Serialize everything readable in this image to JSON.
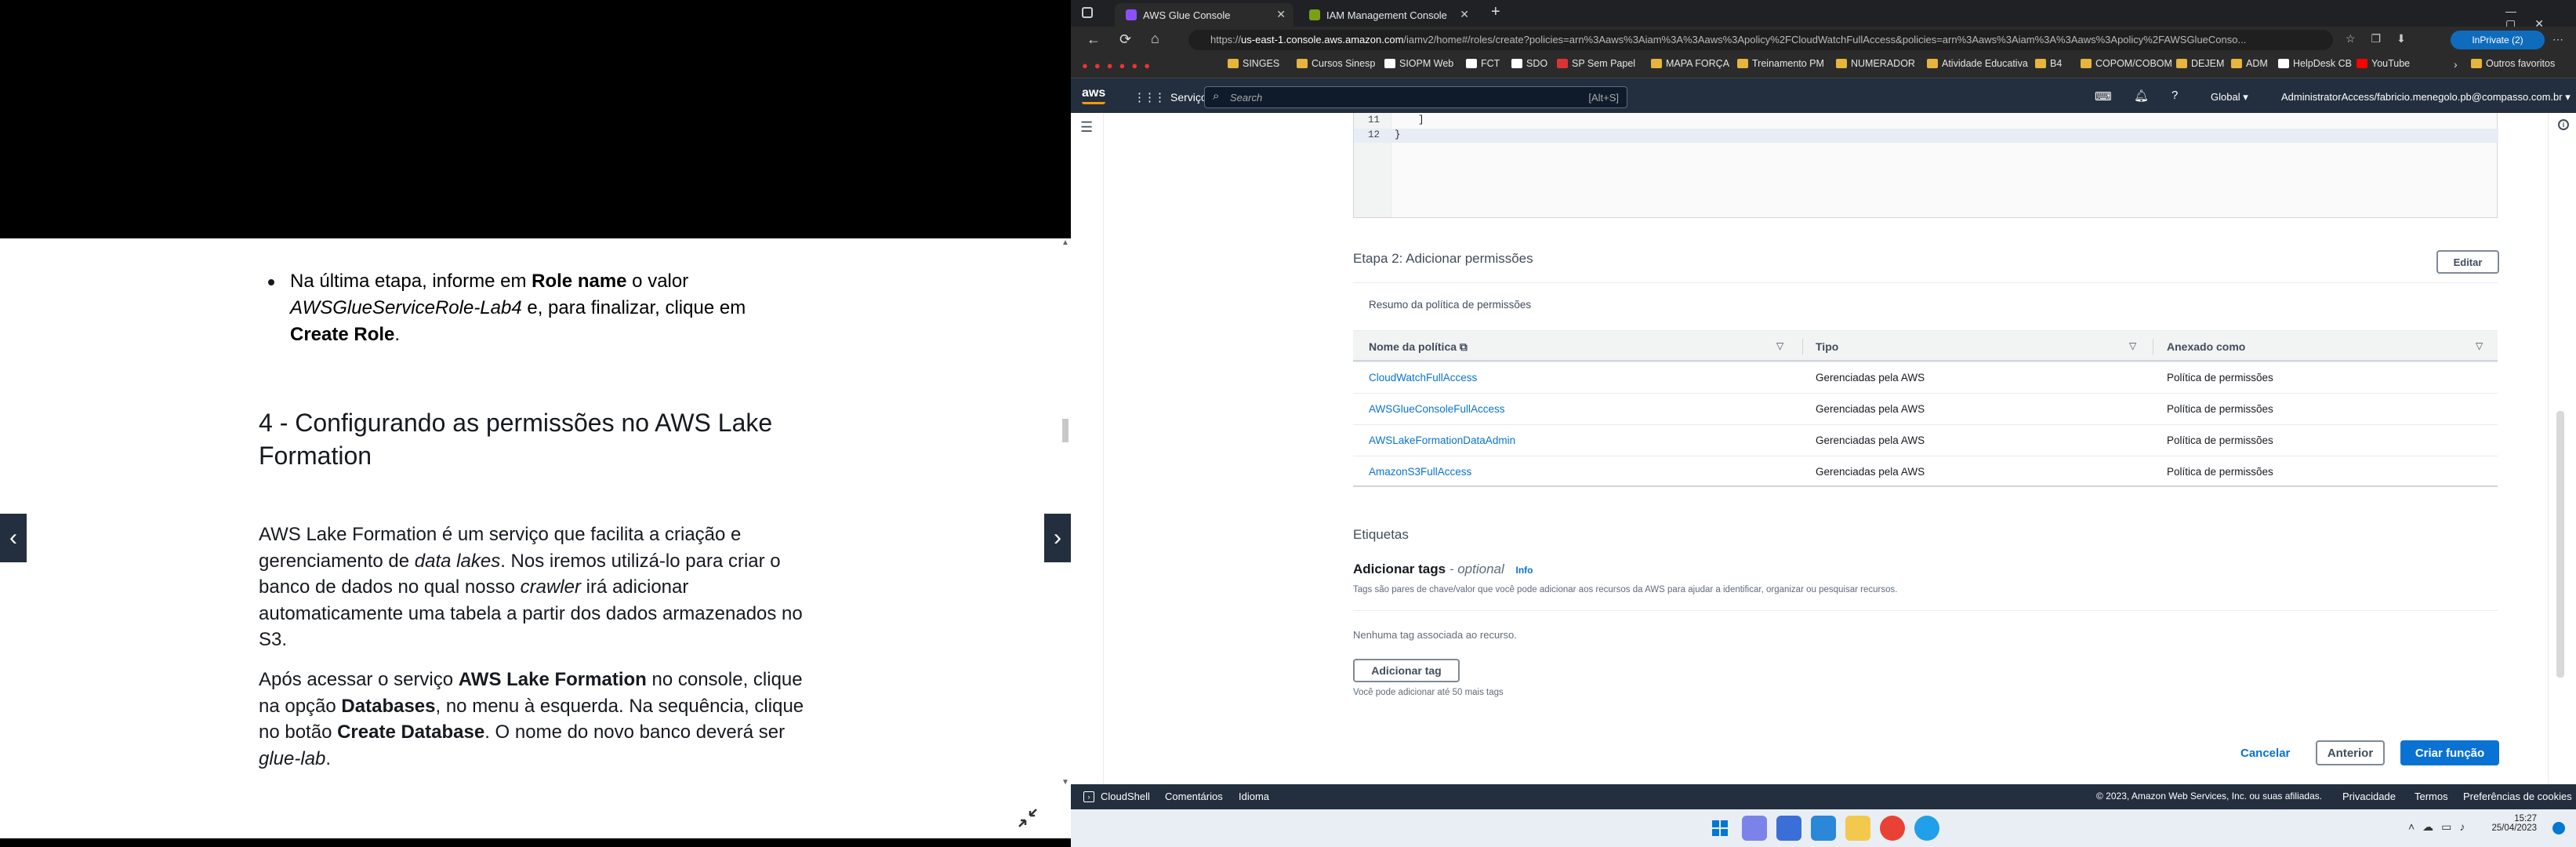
{
  "doc": {
    "bullet": {
      "t1": "Na última etapa, informe em ",
      "b1": "Role name",
      "t2": " o valor ",
      "i1": "AWSGlueServiceRole-Lab4",
      "t3": " e, para finalizar, clique em ",
      "b2": "Create Role",
      "t4": "."
    },
    "heading": "4 - Configurando as permissões no AWS Lake Formation",
    "p1": {
      "t1": "AWS Lake Formation é um serviço que facilita a criação e gerenciamento de ",
      "i1": "data lakes",
      "t2": ". Nos iremos utilizá-lo para criar o banco de dados no qual nosso ",
      "i2": "crawler",
      "t3": " irá adicionar automaticamente uma tabela a partir dos dados armazenados no S3."
    },
    "p2": {
      "t1": "Após acessar o serviço ",
      "b1": "AWS Lake Formation",
      "t2": " no console, clique na opção ",
      "b2": "Databases",
      "t3": ", no menu à esquerda. Na sequência, clique no botão ",
      "b3": "Create Database",
      "t4": ". O nome do novo banco deverá ser ",
      "i1": "glue-lab",
      "t5": "."
    }
  },
  "browser": {
    "tabs": [
      {
        "label": "AWS Glue Console"
      },
      {
        "label": "IAM Management Console"
      }
    ],
    "url_prefix": "https://",
    "url_host": "us-east-1.console.aws.amazon.com",
    "url_rest": "/iamv2/home#/roles/create?policies=arn%3Aaws%3Aiam%3A%3Aaws%3Apolicy%2FCloudWatchFullAccess&policies=arn%3Aaws%3Aiam%3A%3Aaws%3Apolicy%2FAWSGlueConso...",
    "inprivate": "InPrivate (2)",
    "bookmarks": [
      "SINGES",
      "Cursos Sinesp",
      "SIOPM Web",
      "FCT",
      "SDO",
      "SP Sem Papel",
      "MAPA FORÇA",
      "Treinamento PM",
      "NUMERADOR",
      "Atividade Educativa",
      "B4",
      "COPOM/COBOM",
      "DEJEM",
      "ADM",
      "HelpDesk CB",
      "YouTube"
    ],
    "other_favorites": "Outros favoritos"
  },
  "awsnav": {
    "logo": "aws",
    "services": "Serviços",
    "search_placeholder": "Search",
    "shortcut": "[Alt+S]",
    "region": "Global",
    "account": "AdministratorAccess/fabricio.menegolo.pb@compasso.com.br"
  },
  "code": {
    "lines": [
      {
        "num": "11",
        "text": "    ]"
      },
      {
        "num": "12",
        "text": "}"
      }
    ]
  },
  "step2": {
    "title": "Etapa 2: Adicionar permissões",
    "edit": "Editar",
    "summary": "Resumo da política de permissões",
    "headers": [
      "Nome da política",
      "Tipo",
      "Anexado como"
    ],
    "rows": [
      {
        "name": "CloudWatchFullAccess",
        "type": "Gerenciadas pela AWS",
        "attached": "Política de permissões"
      },
      {
        "name": "AWSGlueConsoleFullAccess",
        "type": "Gerenciadas pela AWS",
        "attached": "Política de permissões"
      },
      {
        "name": "AWSLakeFormationDataAdmin",
        "type": "Gerenciadas pela AWS",
        "attached": "Política de permissões"
      },
      {
        "name": "AmazonS3FullAccess",
        "type": "Gerenciadas pela AWS",
        "attached": "Política de permissões"
      }
    ]
  },
  "tags": {
    "section": "Etiquetas",
    "title": "Adicionar tags",
    "optional": "- optional",
    "info": "Info",
    "desc": "Tags são pares de chave/valor que você pode adicionar aos recursos da AWS para ajudar a identificar, organizar ou pesquisar recursos.",
    "none": "Nenhuma tag associada ao recurso.",
    "add": "Adicionar tag",
    "limit": "Você pode adicionar até 50 mais tags"
  },
  "actions": {
    "cancel": "Cancelar",
    "previous": "Anterior",
    "create": "Criar função"
  },
  "footer": {
    "cloudshell": "CloudShell",
    "feedback": "Comentários",
    "language": "Idioma",
    "copyright": "© 2023, Amazon Web Services, Inc. ou suas afiliadas.",
    "privacy": "Privacidade",
    "terms": "Termos",
    "cookies": "Preferências de cookies"
  },
  "taskbar": {
    "time": "15:27",
    "date": "25/04/2023"
  }
}
